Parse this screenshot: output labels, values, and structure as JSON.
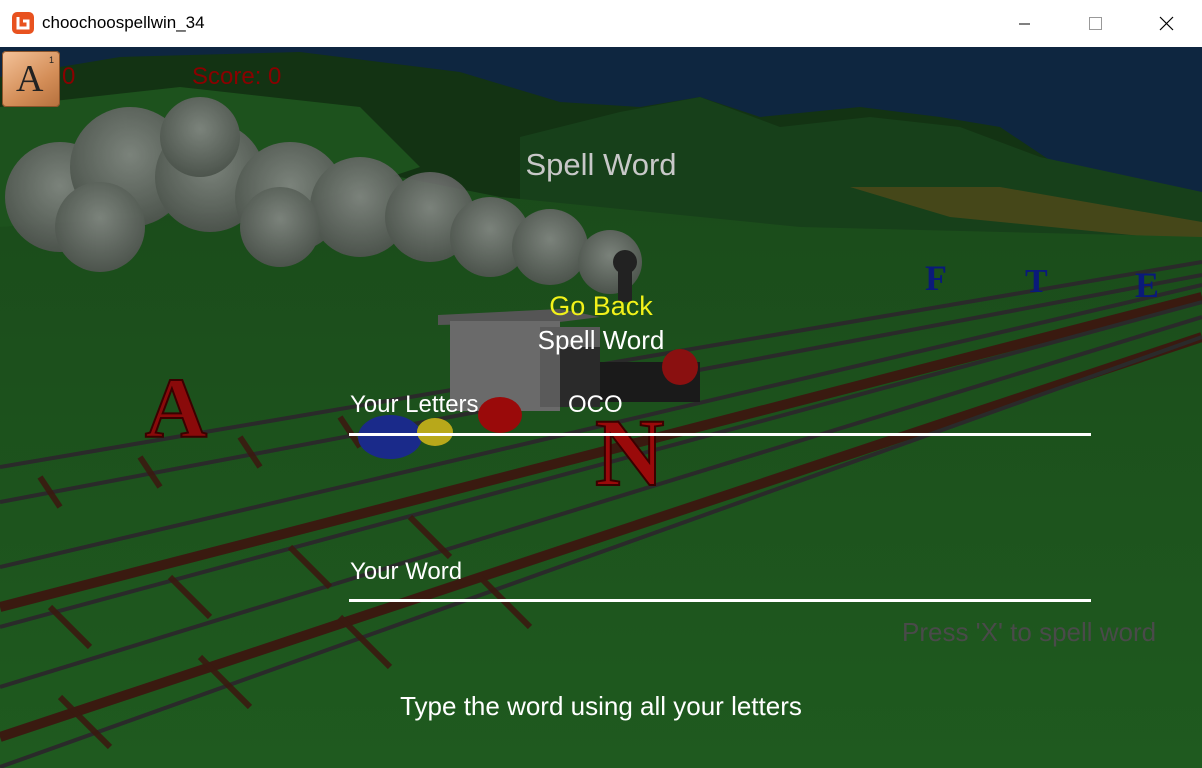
{
  "window": {
    "title": "choochoospellwin_34"
  },
  "hud": {
    "tile_letter": "A",
    "tile_points": "1",
    "tile_count": "0",
    "score": "Score: 0"
  },
  "menu": {
    "title": "Spell Word",
    "go_back": "Go Back",
    "spell_word": "Spell Word",
    "your_letters_label": "Your Letters",
    "your_letters_value": "OCO",
    "your_word_label": "Your Word",
    "your_word_value": "",
    "press_hint": "Press 'X' to spell word",
    "instructions": "Type the word using all your letters"
  },
  "scene": {
    "track_letters": [
      "A",
      "N",
      "F",
      "T",
      "E"
    ]
  },
  "colors": {
    "grass": "#1e4d1e",
    "sky": "#0e2640",
    "rail": "#2a2a2a",
    "tie": "#3a1a10",
    "highlight": "#f2f21a",
    "hud_red": "#8a0000"
  }
}
